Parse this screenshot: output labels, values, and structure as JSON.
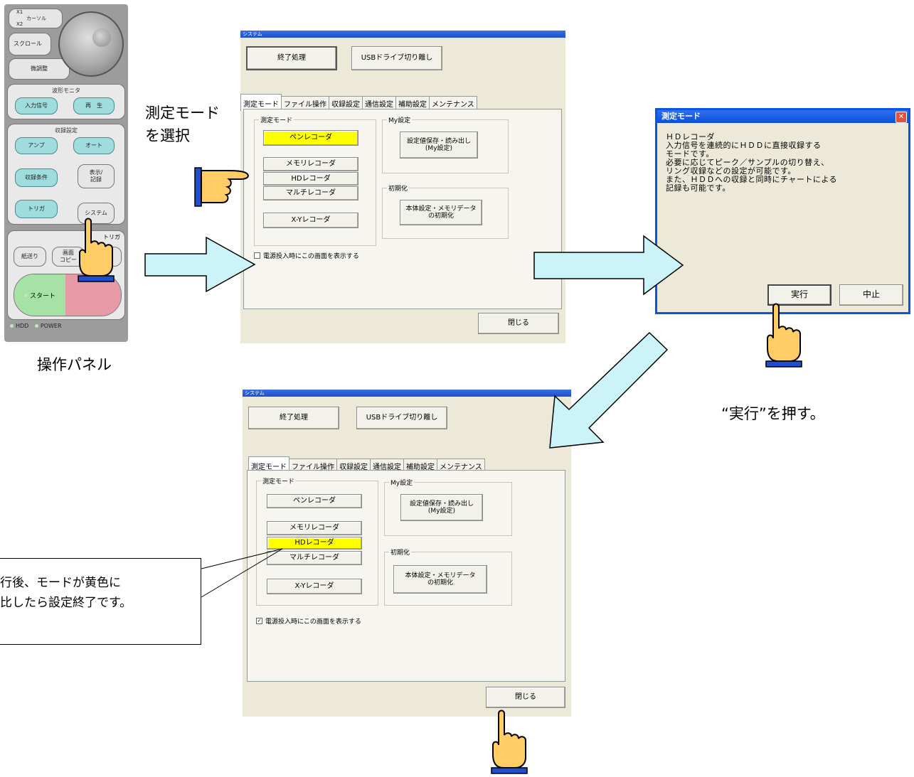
{
  "panel": {
    "cursor_x1": "X1",
    "cursor_label": "カーソル",
    "cursor_x2": "X2",
    "scroll": "スクロール",
    "fine_adjust": "微調整",
    "waveform_monitor": "波形モニタ",
    "input_signal": "入力信号",
    "playback": "再　生",
    "record_settings": "収録設定",
    "amp": "アンプ",
    "auto": "オート",
    "record_condition": "収録条件",
    "display_record": "表示/\n記録",
    "trigger": "トリガ",
    "system": "システム",
    "trigger_group": "トリガ",
    "paper_feed": "紙送り",
    "screen_copy": "画面\nコピー",
    "start": "スタート",
    "hdd": "HDD",
    "power": "POWER"
  },
  "labels": {
    "panel_caption": "操作パネル",
    "select_mode": "測定モード\nを選択",
    "press_execute": "“実行”を押す。",
    "callout_line1": "行後、モードが黄色に",
    "callout_line2": "比したら設定終了です。"
  },
  "window": {
    "title": "システム",
    "shutdown": "終了処理",
    "usb_eject": "USBドライブ切り離し",
    "tabs": [
      "測定モード",
      "ファイル操作",
      "収録設定",
      "通信設定",
      "補助設定",
      "メンテナンス"
    ],
    "mode_group": "測定モード",
    "modes": [
      "ペンレコーダ",
      "メモリレコーダ",
      "HDレコーダ",
      "マルチレコーダ",
      "X-Yレコーダ"
    ],
    "my_settings_group": "My設定",
    "my_settings_button": "設定値保存・読み出し\n(My設定)",
    "init_group": "初期化",
    "init_button": "本体設定・メモリデータ\nの初期化",
    "show_on_power": "電源投入時にこの画面を表示する",
    "close": "閉じる"
  },
  "dialog": {
    "title": "測定モード",
    "text": "ＨＤレコーダ\n入力信号を連続的にＨＤＤに直接収録する\nモードです。\n必要に応じてピーク／サンプルの切り替え、\nリング収録などの設定が可能です。\nまた、ＨＤＤへの収録と同時にチャートによる\n記録も可能です。",
    "execute": "実行",
    "cancel": "中止"
  },
  "window1_state": {
    "selected_mode": "ペンレコーダ",
    "show_on_power_checked": false
  },
  "window2_state": {
    "selected_mode": "HDレコーダ",
    "show_on_power_checked": true
  },
  "colors": {
    "selected": "#ffff00",
    "arrow_fill": "#ccf4f8",
    "hand_fill": "#ffcc66",
    "hand_cuff": "#1f4fd0"
  }
}
